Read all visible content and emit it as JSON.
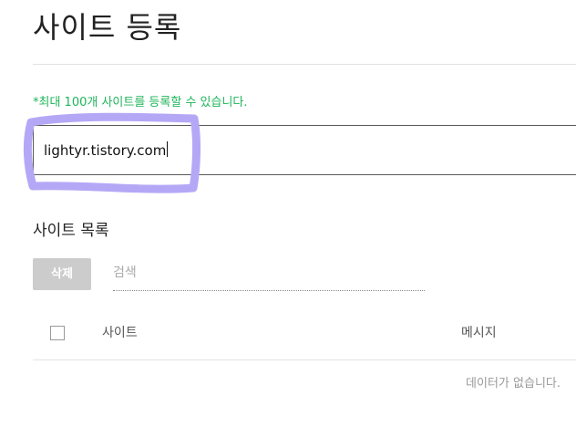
{
  "page": {
    "title": "사이트 등록"
  },
  "register": {
    "limit_notice": "*최대 100개 사이트를 등록할 수 있습니다.",
    "url_value": "lightyr.tistory.com"
  },
  "site_list": {
    "title": "사이트 목록",
    "delete_label": "삭제",
    "search_placeholder": "검색",
    "columns": {
      "site": "사이트",
      "message": "메시지"
    },
    "empty_text": "데이터가 없습니다."
  },
  "colors": {
    "notice_green": "#1eb55a",
    "highlight_purple": "#b4a8f6",
    "disabled_button": "#cccccc"
  }
}
